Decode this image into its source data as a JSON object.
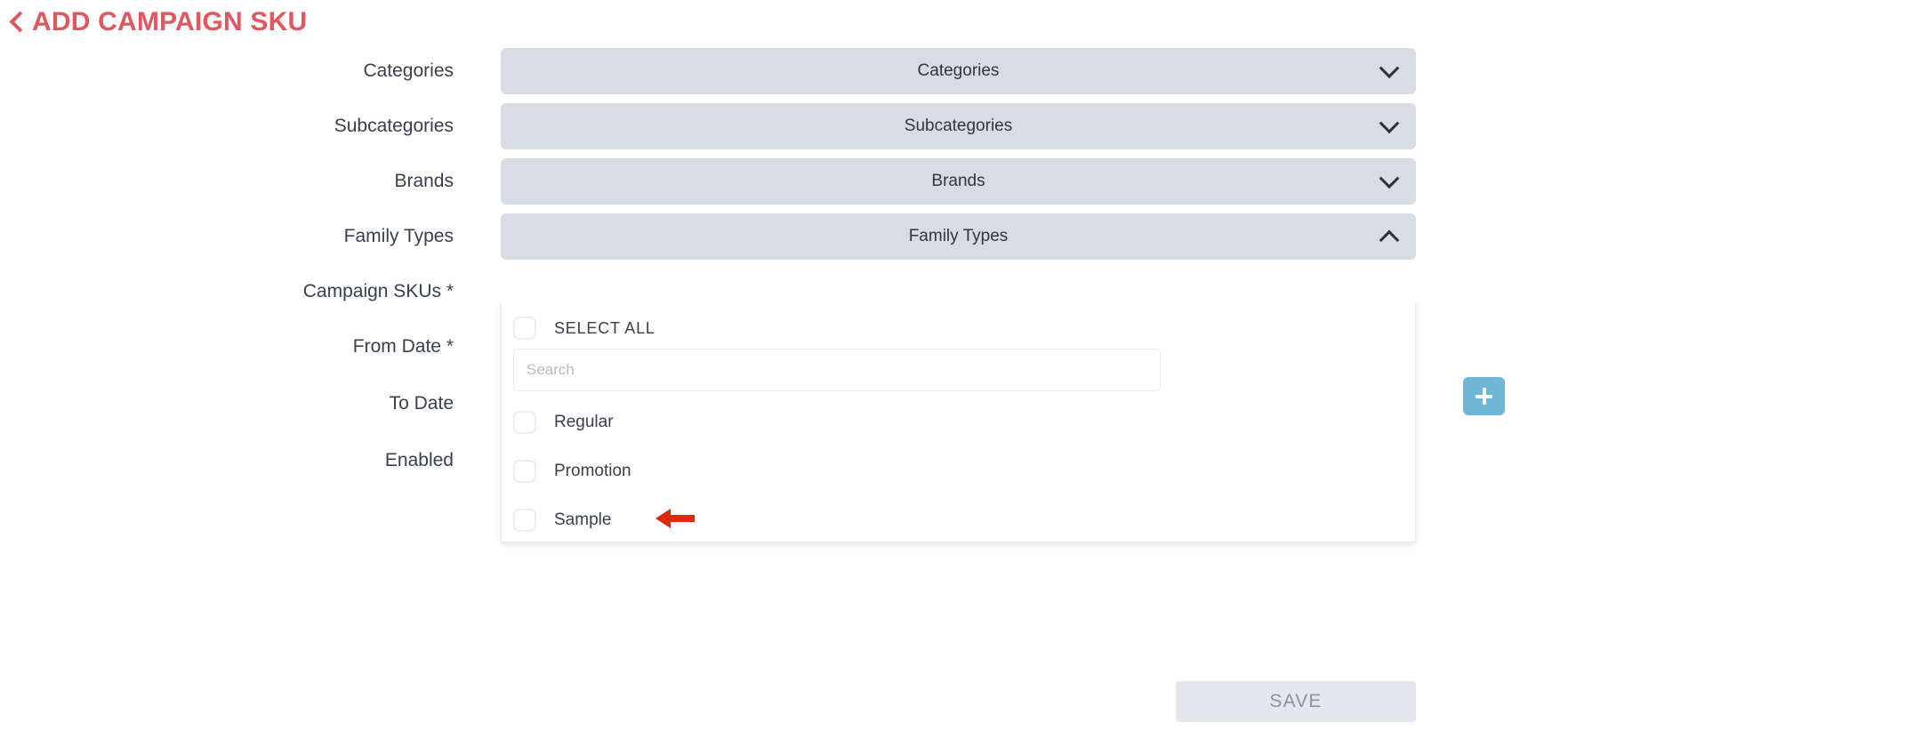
{
  "header": {
    "back_icon": "chevron-left-icon",
    "title": "ADD CAMPAIGN SKU",
    "title_color": "#E0585F"
  },
  "form": {
    "rows": [
      {
        "label": "Categories",
        "control": "select",
        "value": "Categories",
        "icon": "chevron-down-icon",
        "expanded": false
      },
      {
        "label": "Subcategories",
        "control": "select",
        "value": "Subcategories",
        "icon": "chevron-down-icon",
        "expanded": false
      },
      {
        "label": "Brands",
        "control": "select",
        "value": "Brands",
        "icon": "chevron-down-icon",
        "expanded": false
      },
      {
        "label": "Family Types",
        "control": "select",
        "value": "Family Types",
        "icon": "chevron-up-icon",
        "expanded": true
      },
      {
        "label": "Campaign SKUs *",
        "control": "hidden"
      },
      {
        "label": "From Date *",
        "control": "hidden"
      },
      {
        "label": "To Date",
        "control": "hidden"
      },
      {
        "label": "Enabled",
        "control": "hidden"
      }
    ]
  },
  "dropdown": {
    "select_all_label": "SELECT ALL",
    "select_all_checked": false,
    "search": {
      "value": "",
      "placeholder": "Search",
      "icon": "search-input"
    },
    "options": [
      {
        "label": "Regular",
        "checked": false,
        "annotated": true
      },
      {
        "label": "Promotion",
        "checked": false,
        "annotated": false
      },
      {
        "label": "Sample",
        "checked": false,
        "annotated": false
      }
    ]
  },
  "annotation": {
    "arrow_icon": "arrow-left-icon",
    "arrow_color": "#DC2A0A",
    "points_at": "Regular"
  },
  "actions": {
    "add_label": "",
    "add_icon": "plus-icon",
    "add_color": "#6FB7D6",
    "save_label": "SAVE",
    "save_disabled": true
  },
  "colors": {
    "select_background": "#D6DDE4",
    "label_text": "#39404C",
    "panel_background": "#FFFFFF",
    "save_background": "#E4E8EC"
  }
}
